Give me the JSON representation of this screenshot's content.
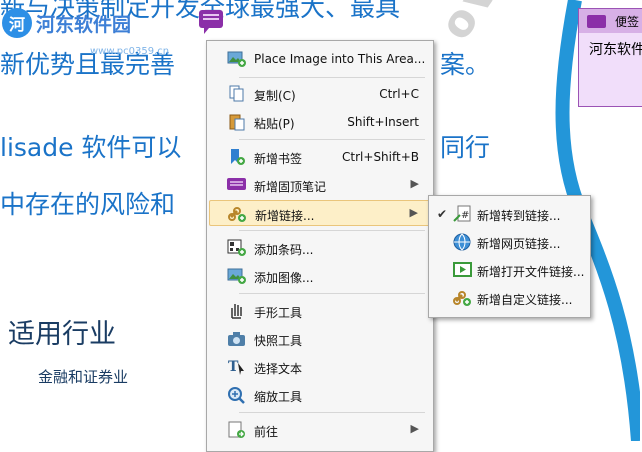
{
  "document": {
    "lines": [
      "新与决策制定开发全球最强大、最具",
      "新优势且最完善",
      "lisade 软件可以",
      "中存在的风险和"
    ],
    "right_fragments": [
      "案。",
      "同行"
    ],
    "heading": "适用行业",
    "subheading": "金融和证券业",
    "watermark": "overs"
  },
  "logo": {
    "text": "河东软件园",
    "url": "www.pc0359.cn"
  },
  "popup_note": {
    "title": "便签",
    "body": "河东软件"
  },
  "context_menu": {
    "items": [
      {
        "label": "Place Image into This Area...",
        "shortcut": "",
        "icon": "image-place-icon"
      },
      {
        "label": "复制(C)",
        "shortcut": "Ctrl+C",
        "icon": "copy-icon"
      },
      {
        "label": "粘贴(P)",
        "shortcut": "Shift+Insert",
        "icon": "paste-icon"
      },
      {
        "label": "新增书签",
        "shortcut": "Ctrl+Shift+B",
        "icon": "bookmark-add-icon"
      },
      {
        "label": "新增固顶笔记",
        "shortcut": "",
        "icon": "note-add-icon"
      },
      {
        "label": "新增链接...",
        "shortcut": "",
        "icon": "link-add-icon"
      },
      {
        "label": "添加条码...",
        "shortcut": "",
        "icon": "barcode-add-icon"
      },
      {
        "label": "添加图像...",
        "shortcut": "",
        "icon": "image-add-icon"
      },
      {
        "label": "手形工具",
        "shortcut": "",
        "icon": "hand-tool-icon"
      },
      {
        "label": "快照工具",
        "shortcut": "",
        "icon": "camera-icon"
      },
      {
        "label": "选择文本",
        "shortcut": "",
        "icon": "select-text-icon"
      },
      {
        "label": "缩放工具",
        "shortcut": "",
        "icon": "zoom-icon"
      },
      {
        "label": "前往",
        "shortcut": "",
        "icon": "goto-icon"
      }
    ]
  },
  "link_submenu": {
    "items": [
      {
        "label": "新增转到链接...",
        "checked": true,
        "icon": "goto-link-icon"
      },
      {
        "label": "新增网页链接...",
        "checked": false,
        "icon": "web-link-icon"
      },
      {
        "label": "新增打开文件链接...",
        "checked": false,
        "icon": "open-file-link-icon"
      },
      {
        "label": "新增自定义链接...",
        "checked": false,
        "icon": "custom-link-icon"
      }
    ]
  },
  "colors": {
    "accent_text": "#1a73c8",
    "menu_highlight": "#fdefc8",
    "note_purple": "#8b2fa8"
  }
}
